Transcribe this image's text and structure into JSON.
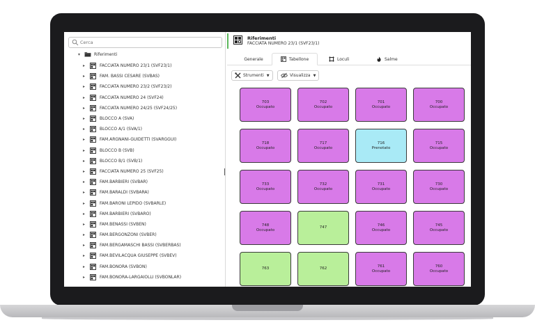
{
  "colors": {
    "occupato": "#d87ae8",
    "prenotato": "#a9eaf6",
    "libero": "#b9ef9a",
    "accent": "#5cb85c",
    "laptop_frame": "#1b1b1d"
  },
  "search": {
    "placeholder": "Cerca",
    "icon": "search-icon"
  },
  "tree": {
    "root_label": "Riferimenti",
    "items": [
      "FACCIATA NUMERO 23/1 (SVF23/1)",
      "FAM. BASSI CESARE (SVBAS)",
      "FACCIATA NUMERO 23/2 (SVF23/2)",
      "FACCIATA NUMERO 24 (SVF24)",
      "FACCIATA NUMERO 24/25 (SVF24/25)",
      "BLOCCO A (SVA)",
      "BLOCCO A/1 (SVA/1)",
      "FAM.ARGNANI-GUIDETTI (SVARGGUI)",
      "BLOCCO B (SVB)",
      "BLOCCO B/1 (SVB/1)",
      "FACCIATA NUMERO 25 (SVF25)",
      "FAM.BARBIERI (SVBAR)",
      "FAM.BARALDI (SVBARA)",
      "FAM.BARONI LEPIDO (SVBARLE)",
      "FAM.BARBIERI (SVBARO)",
      "FAM.BENASSI (SVBEN)",
      "FAM.BERGONZONI (SVBER)",
      "FAM.BERGAMASCHI BASSI (SVBERBAS)",
      "FAM.BEVILACQUA GIUSEPPE (SVBEV)",
      "FAM.BONORA (SVBON)",
      "FAM.BONORA-LARGAIOLLI (SVBONLAR)"
    ]
  },
  "header": {
    "title": "Riferimenti",
    "subtitle": "FACCIATA NUMERO 23/1 (SVF23/1)"
  },
  "tabs": {
    "generale": "Generale",
    "tabellone": "Tabellone",
    "loculi": "Loculi",
    "salme": "Salme"
  },
  "toolbar": {
    "strumenti": "Strumenti",
    "visualizza": "Visualizza"
  },
  "cells": [
    {
      "num": "703",
      "status": "Occupato",
      "state": "occupato"
    },
    {
      "num": "702",
      "status": "Occupato",
      "state": "occupato"
    },
    {
      "num": "701",
      "status": "Occupato",
      "state": "occupato"
    },
    {
      "num": "700",
      "status": "Occupato",
      "state": "occupato"
    },
    {
      "num": "718",
      "status": "Occupato",
      "state": "occupato"
    },
    {
      "num": "717",
      "status": "Occupato",
      "state": "occupato"
    },
    {
      "num": "716",
      "status": "Prenotato",
      "state": "prenotato"
    },
    {
      "num": "715",
      "status": "Occupato",
      "state": "occupato"
    },
    {
      "num": "733",
      "status": "Occupato",
      "state": "occupato"
    },
    {
      "num": "732",
      "status": "Occupato",
      "state": "occupato"
    },
    {
      "num": "731",
      "status": "Occupato",
      "state": "occupato"
    },
    {
      "num": "730",
      "status": "Occupato",
      "state": "occupato"
    },
    {
      "num": "748",
      "status": "Occupato",
      "state": "occupato"
    },
    {
      "num": "747",
      "status": "",
      "state": "libero"
    },
    {
      "num": "746",
      "status": "Occupato",
      "state": "occupato"
    },
    {
      "num": "745",
      "status": "Occupato",
      "state": "occupato"
    },
    {
      "num": "763",
      "status": "",
      "state": "libero"
    },
    {
      "num": "762",
      "status": "",
      "state": "libero"
    },
    {
      "num": "761",
      "status": "Occupato",
      "state": "occupato"
    },
    {
      "num": "760",
      "status": "Occupato",
      "state": "occupato"
    }
  ]
}
